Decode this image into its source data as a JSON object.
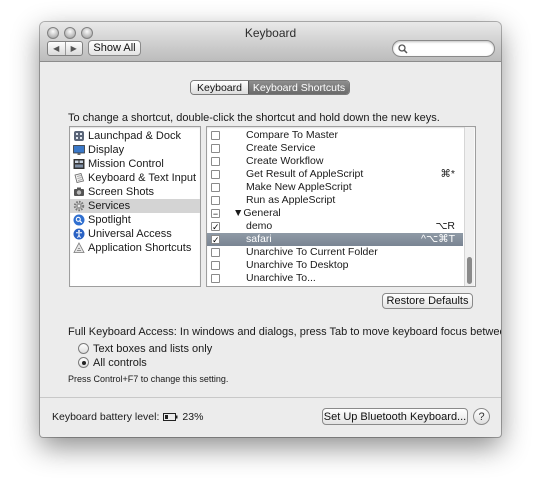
{
  "window": {
    "title": "Keyboard"
  },
  "toolbar": {
    "back": "◀",
    "forward": "▶",
    "show_all_label": "Show All",
    "search_placeholder": ""
  },
  "tabs": [
    {
      "label": "Keyboard",
      "selected": false
    },
    {
      "label": "Keyboard Shortcuts",
      "selected": true
    }
  ],
  "instruction": "To change a shortcut, double-click the shortcut and hold down the new keys.",
  "categories": [
    {
      "label": "Launchpad & Dock",
      "icon": "launchpad-icon",
      "selected": false
    },
    {
      "label": "Display",
      "icon": "display-icon",
      "selected": false
    },
    {
      "label": "Mission Control",
      "icon": "mission-control-icon",
      "selected": false
    },
    {
      "label": "Keyboard & Text Input",
      "icon": "keyboard-icon",
      "selected": false
    },
    {
      "label": "Screen Shots",
      "icon": "screenshot-icon",
      "selected": false
    },
    {
      "label": "Services",
      "icon": "gear-icon",
      "selected": true
    },
    {
      "label": "Spotlight",
      "icon": "spotlight-icon",
      "selected": false
    },
    {
      "label": "Universal Access",
      "icon": "universal-access-icon",
      "selected": false
    },
    {
      "label": "Application Shortcuts",
      "icon": "app-shortcuts-icon",
      "selected": false
    }
  ],
  "shortcuts": [
    {
      "label": "Compare To Master",
      "check": "",
      "key": ""
    },
    {
      "label": "Create Service",
      "check": "",
      "key": ""
    },
    {
      "label": "Create Workflow",
      "check": "",
      "key": ""
    },
    {
      "label": "Get Result of AppleScript",
      "check": "",
      "key": "⌘*"
    },
    {
      "label": "Make New AppleScript",
      "check": "",
      "key": ""
    },
    {
      "label": "Run as AppleScript",
      "check": "",
      "key": ""
    },
    {
      "label": "▼General",
      "check": "−",
      "key": "",
      "group": true
    },
    {
      "label": "demo",
      "check": "✓",
      "key": "⌥R"
    },
    {
      "label": "safari",
      "check": "✓",
      "key": "^⌥⌘T",
      "selected": true
    },
    {
      "label": "Unarchive To Current Folder",
      "check": "",
      "key": ""
    },
    {
      "label": "Unarchive To Desktop",
      "check": "",
      "key": ""
    },
    {
      "label": "Unarchive To...",
      "check": "",
      "key": ""
    }
  ],
  "restore_defaults_label": "Restore Defaults",
  "full_keyboard_access": {
    "label": "Full Keyboard Access: In windows and dialogs, press Tab to move keyboard focus between:",
    "options": [
      {
        "label": "Text boxes and lists only",
        "selected": false
      },
      {
        "label": "All controls",
        "selected": true
      }
    ],
    "hint": "Press Control+F7 to change this setting."
  },
  "battery": {
    "label": "Keyboard battery level:",
    "value": "23%"
  },
  "bluetooth_button_label": "Set Up Bluetooth Keyboard...",
  "help_label": "?",
  "colors": {
    "selection": "#7d8896",
    "window_bg": "#ececec"
  }
}
